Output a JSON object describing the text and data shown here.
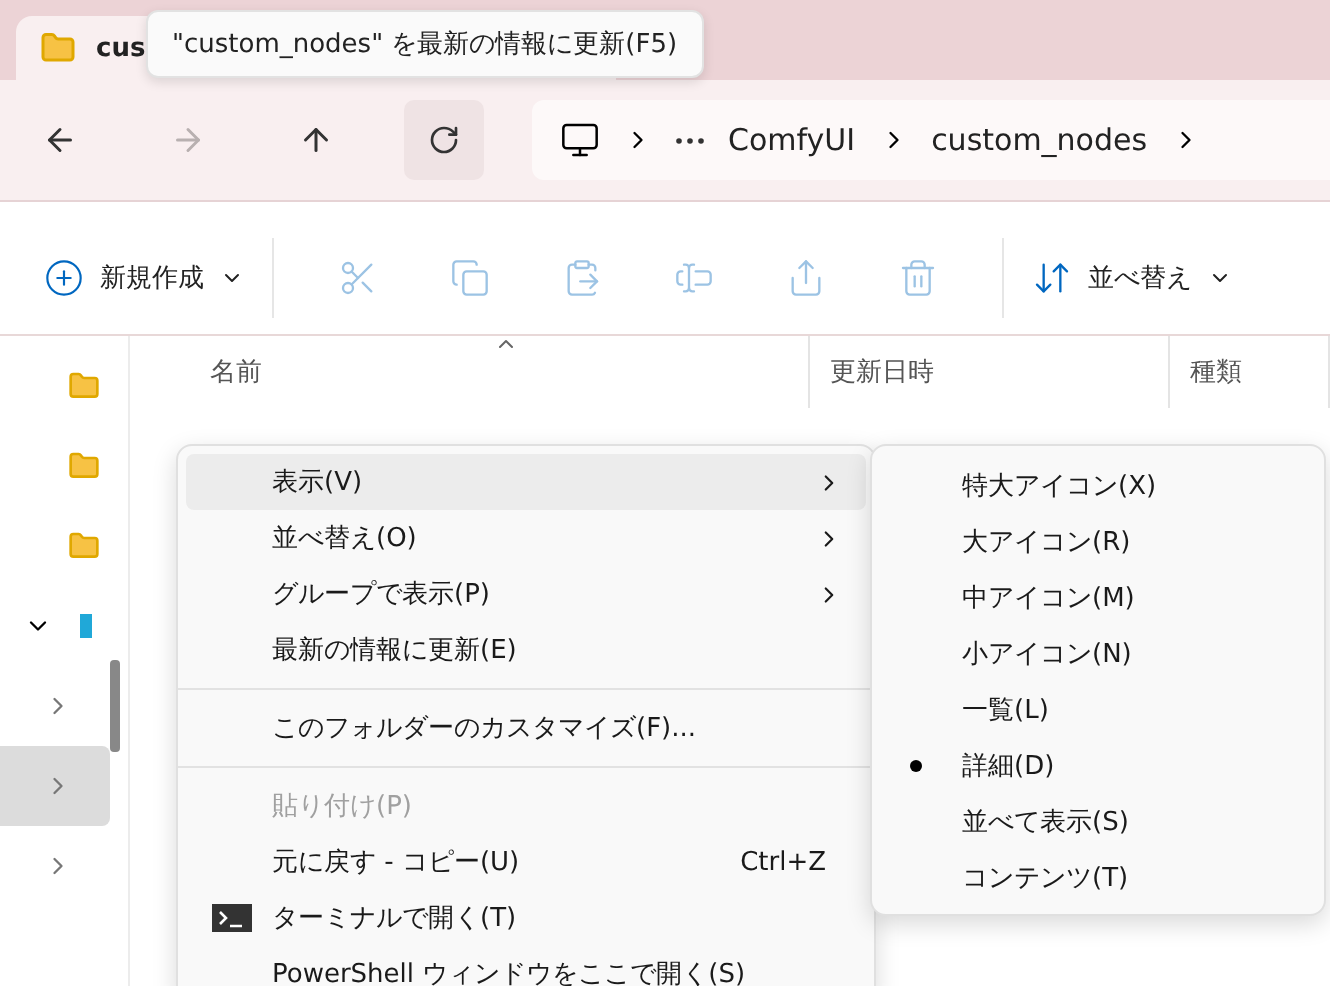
{
  "tab": {
    "title": "cus"
  },
  "tooltip": {
    "text": "\"custom_nodes\" を最新の情報に更新(F5)"
  },
  "nav_buttons": [
    {
      "kind": "back",
      "disabled": false,
      "selected": false
    },
    {
      "kind": "forward",
      "disabled": true,
      "selected": false
    },
    {
      "kind": "up",
      "disabled": false,
      "selected": false
    },
    {
      "kind": "refresh",
      "disabled": false,
      "selected": true
    }
  ],
  "breadcrumb": [
    "ComfyUI",
    "custom_nodes"
  ],
  "toolbar": {
    "new_label": "新規作成",
    "actions": [
      {
        "kind": "cut",
        "disabled": true
      },
      {
        "kind": "copy",
        "disabled": true
      },
      {
        "kind": "paste",
        "disabled": true
      },
      {
        "kind": "rename",
        "disabled": true
      },
      {
        "kind": "share",
        "disabled": true
      },
      {
        "kind": "delete",
        "disabled": true
      }
    ],
    "sort_label": "並べ替え"
  },
  "columns": [
    "名前",
    "更新日時",
    "種類"
  ],
  "sidebar": [
    {
      "kind": "folder"
    },
    {
      "kind": "folder"
    },
    {
      "kind": "folder"
    },
    {
      "kind": "drive",
      "expanded": true
    },
    {
      "kind": "node",
      "expanded": false,
      "selected": false
    },
    {
      "kind": "node",
      "expanded": false,
      "selected": true
    },
    {
      "kind": "node",
      "expanded": false,
      "selected": false
    }
  ],
  "context_menu": [
    {
      "kind": "item",
      "label": "表示(V)",
      "submenu": true,
      "selected": true
    },
    {
      "kind": "item",
      "label": "並べ替え(O)",
      "submenu": true,
      "selected": false
    },
    {
      "kind": "item",
      "label": "グループで表示(P)",
      "submenu": true,
      "selected": false
    },
    {
      "kind": "item",
      "label": "最新の情報に更新(E)",
      "selected": false
    },
    {
      "kind": "separator"
    },
    {
      "kind": "item",
      "label": "このフォルダーのカスタマイズ(F)...",
      "selected": false
    },
    {
      "kind": "separator"
    },
    {
      "kind": "item",
      "label": "貼り付け(P)",
      "disabled": true,
      "selected": false
    },
    {
      "kind": "item",
      "label": "元に戻す - コピー(U)",
      "shortcut": "Ctrl+Z",
      "selected": false
    },
    {
      "kind": "terminal",
      "label": "ターミナルで開く(T)",
      "selected": false
    },
    {
      "kind": "item",
      "label": "PowerShell ウィンドウをここで開く(S)",
      "selected": false
    }
  ],
  "view_submenu": [
    {
      "label": "特大アイコン(X)",
      "selected": false
    },
    {
      "label": "大アイコン(R)",
      "selected": false
    },
    {
      "label": "中アイコン(M)",
      "selected": false
    },
    {
      "label": "小アイコン(N)",
      "selected": false
    },
    {
      "label": "一覧(L)",
      "selected": false
    },
    {
      "label": "詳細(D)",
      "selected": true
    },
    {
      "label": "並べて表示(S)",
      "selected": false
    },
    {
      "label": "コンテンツ(T)",
      "selected": false
    }
  ]
}
